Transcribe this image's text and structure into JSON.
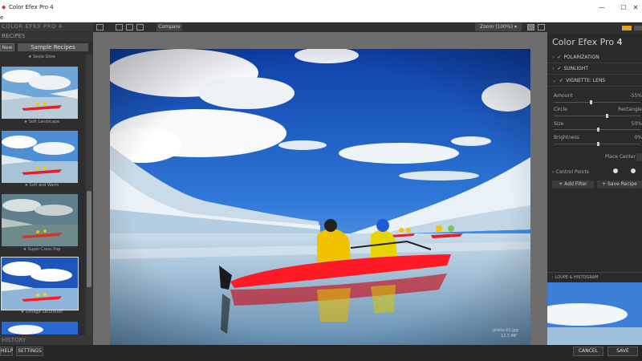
{
  "window": {
    "title": "Color Efex Pro 4",
    "menu_first": "e",
    "minimize": "—",
    "maximize": "☐",
    "close": "✕"
  },
  "left_panel": {
    "header": "COLOR EFEX PRO 4",
    "recipes_label": "RECIPES",
    "tab_new": "New",
    "tab_sample": "Sample Recipes",
    "recipes": [
      {
        "label": "Sepia Glow"
      },
      {
        "label": "Soft Landscape"
      },
      {
        "label": "Soft and Warm"
      },
      {
        "label": "Super Cross Pop"
      },
      {
        "label": "Vintage Saturation"
      }
    ],
    "history_label": "HISTORY"
  },
  "toolbar": {
    "compare": "Compare",
    "zoom": "Zoom (100%)",
    "zoom_arrow": "▾"
  },
  "photo": {
    "filename": "photo-01.jpg",
    "filesize": "12.5 MP"
  },
  "right_panel": {
    "brand": "Color Efex Pro",
    "brand_version": "4",
    "filters": [
      {
        "name": "POLARIZATION",
        "checked": true,
        "expanded": false
      },
      {
        "name": "SUNLIGHT",
        "checked": true,
        "expanded": false
      },
      {
        "name": "VIGNETTE: LENS",
        "checked": true,
        "expanded": true
      }
    ],
    "controls": {
      "amount_label": "Amount",
      "amount_value": "-55%",
      "circle_label": "Circle",
      "rect_label": "Rectangle",
      "size_label": "Size",
      "size_value": "50%",
      "brightness_label": "Brightness",
      "brightness_value": "0%",
      "place_center": "Place Center",
      "control_points": "Control Points"
    },
    "add_filter": "Add Filter",
    "save_recipe": "Save Recipe",
    "loupe_label": "LOUPE & HISTOGRAM"
  },
  "bottom_bar": {
    "help": "HELP",
    "settings": "SETTINGS",
    "cancel": "CANCEL",
    "save": "SAVE"
  },
  "colors": {
    "accent": "#e8a020",
    "kayak": "#e0202a",
    "panel_bg": "#2e2e2e"
  }
}
